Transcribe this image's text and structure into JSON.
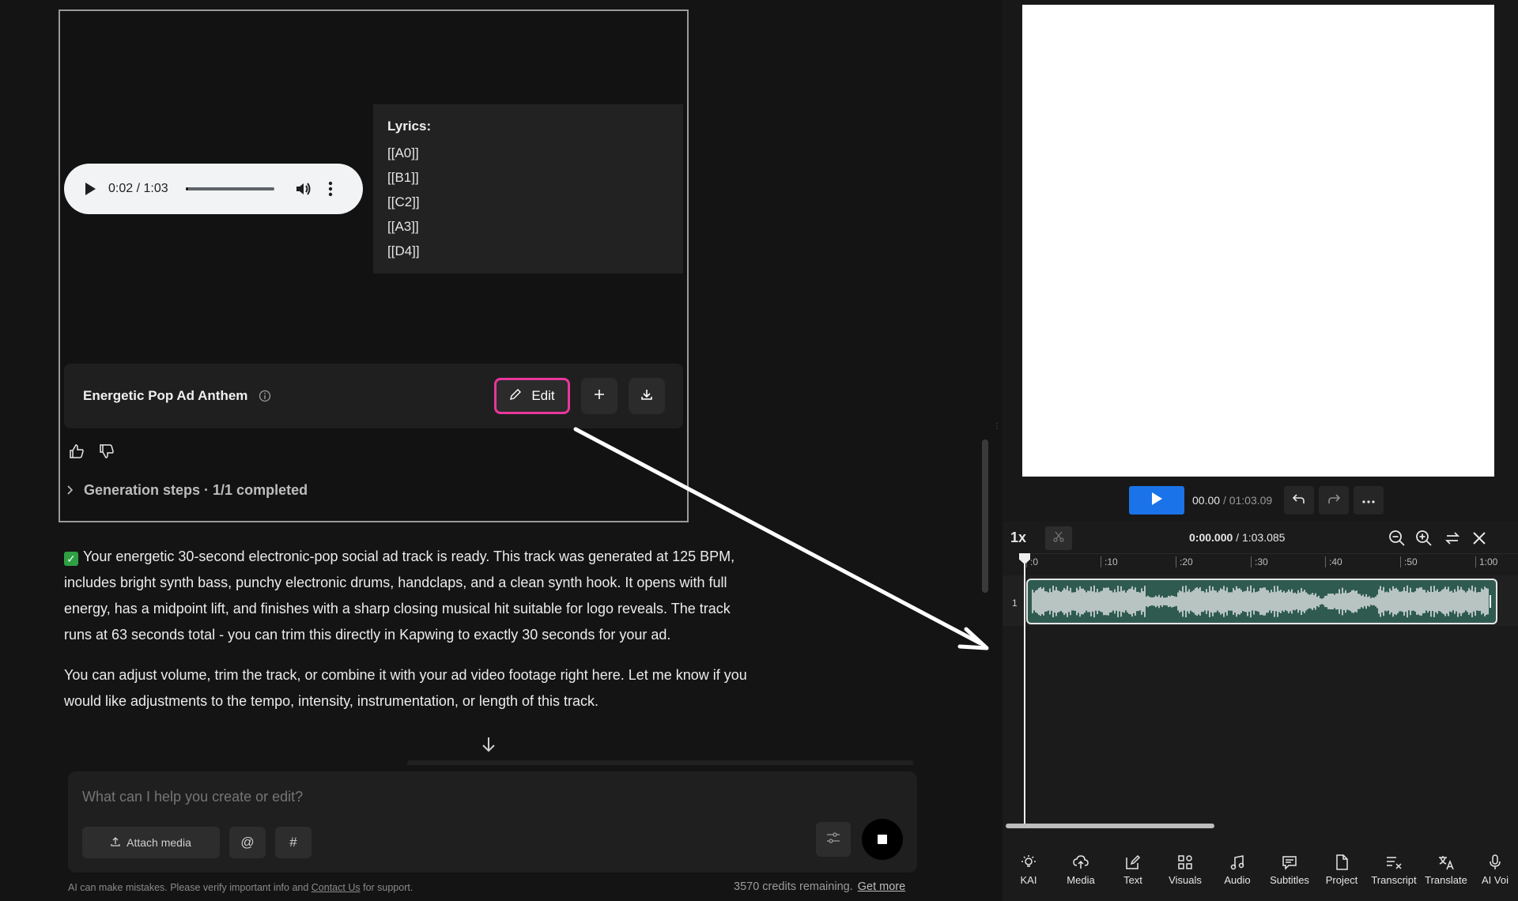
{
  "player": {
    "time": "0:02 / 1:03",
    "progress": 0.03
  },
  "lyrics": {
    "title": "Lyrics:",
    "lines": [
      "[[A0]]",
      "[[B1]]",
      "[[C2]]",
      "[[A3]]",
      "[[D4]]"
    ]
  },
  "track": {
    "title": "Energetic Pop Ad Anthem",
    "edit_label": "Edit"
  },
  "generation": {
    "label": "Generation steps · 1/1 completed"
  },
  "message": {
    "p1": "Your energetic 30-second electronic-pop social ad track is ready. This track was generated at 125 BPM, includes bright synth bass, punchy electronic drums, handclaps, and a clean synth hook. It opens with full energy, has a midpoint lift, and finishes with a sharp closing musical hit suitable for logo reveals. The track runs at 63 seconds total - you can trim this directly in Kapwing to exactly 30 seconds for your ad.",
    "p2": "You can adjust volume, trim the track, or combine it with your ad video footage right here. Let me know if you would like adjustments to the tempo, intensity, instrumentation, or length of this track."
  },
  "composer": {
    "placeholder": "What can I help you create or edit?",
    "attach_label": "Attach media",
    "mention_label": "@",
    "hash_label": "#"
  },
  "footer": {
    "disclaimer_pre": "AI can make mistakes. Please verify important info and ",
    "contact_label": "Contact Us",
    "disclaimer_post": " for support.",
    "credits": "3570 credits remaining.",
    "get_more": "Get more"
  },
  "editor": {
    "current_time": "00.00",
    "total_time": "/ 01:03.09",
    "speed": "1x",
    "tl_current": "0:00.000",
    "tl_total": "/ 1:03.085",
    "track_number": "1",
    "ruler": [
      ":0",
      ":10",
      ":20",
      ":30",
      ":40",
      ":50",
      "1:00"
    ],
    "nav": [
      "KAI",
      "Media",
      "Text",
      "Visuals",
      "Audio",
      "Subtitles",
      "Project",
      "Transcript",
      "Translate",
      "AI Voi"
    ]
  },
  "colors": {
    "accent_edit": "#e8379b",
    "play_blue": "#1a73e8",
    "clip_green": "#2f5a50"
  }
}
